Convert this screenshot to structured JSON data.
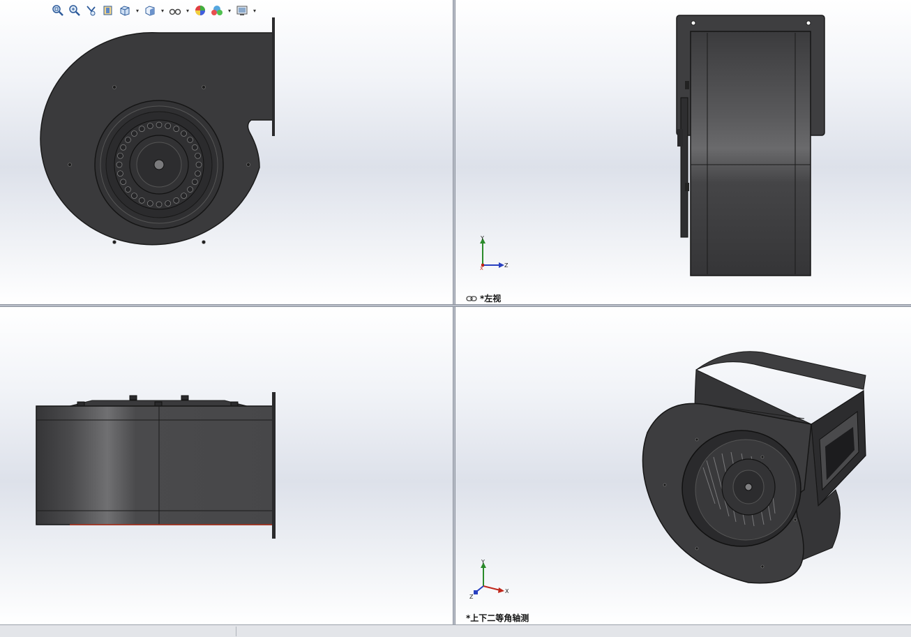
{
  "toolbar": {
    "buttons": [
      {
        "name": "zoom-to-fit-icon",
        "has_dropdown": false
      },
      {
        "name": "zoom-to-area-icon",
        "has_dropdown": false
      },
      {
        "name": "previous-view-icon",
        "has_dropdown": false
      },
      {
        "name": "section-view-icon",
        "has_dropdown": false
      },
      {
        "name": "view-orientation-icon",
        "has_dropdown": true
      },
      {
        "name": "display-style-icon",
        "has_dropdown": true
      },
      {
        "name": "hide-show-items-icon",
        "has_dropdown": true
      },
      {
        "name": "edit-appearance-icon",
        "has_dropdown": false
      },
      {
        "name": "apply-scene-icon",
        "has_dropdown": true
      },
      {
        "name": "view-settings-icon",
        "has_dropdown": true
      }
    ]
  },
  "viewports": {
    "top_left": {
      "label": ""
    },
    "top_right": {
      "label": "*左视",
      "linked_icon": "link-icon"
    },
    "bottom_left": {
      "label": ""
    },
    "bottom_right": {
      "label": "*上下二等角轴测"
    }
  },
  "triad": {
    "x": "X",
    "y": "Y",
    "z": "Z"
  },
  "colors": {
    "model": "#3a3a3c",
    "axis_x": "#c0281c",
    "axis_y": "#2a8a2a",
    "axis_z": "#2840c0"
  }
}
